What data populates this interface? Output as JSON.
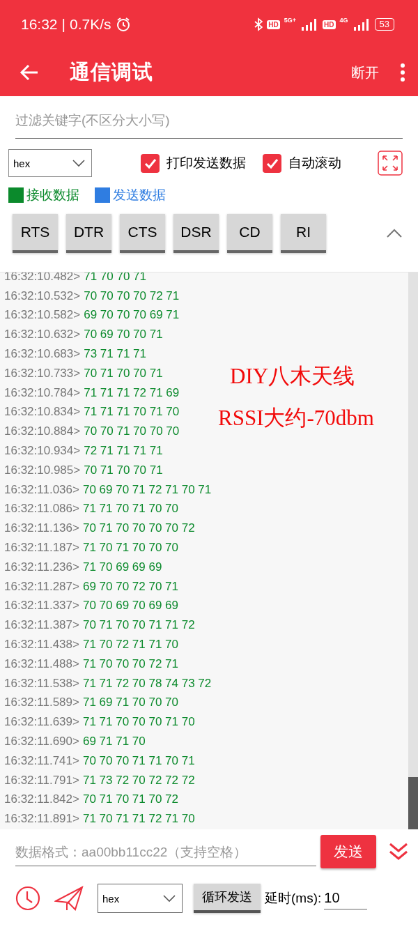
{
  "status_bar": {
    "time": "16:32",
    "separator": "|",
    "speed": "0.7K/s",
    "badges": [
      "HD",
      "5G+",
      "HD",
      "4G"
    ],
    "battery": "53"
  },
  "app_bar": {
    "title": "通信调试",
    "action": "断开"
  },
  "filter": {
    "placeholder": "过滤关键字(不区分大小写)"
  },
  "format_select": {
    "value": "hex"
  },
  "checkboxes": [
    {
      "label": "打印发送数据",
      "checked": true
    },
    {
      "label": "自动滚动",
      "checked": true
    }
  ],
  "legend": [
    {
      "label": "接收数据",
      "color": "#0b8a2c"
    },
    {
      "label": "发送数据",
      "color": "#2f7de1"
    }
  ],
  "signal_buttons": [
    "RTS",
    "DTR",
    "CTS",
    "DSR",
    "CD",
    "RI"
  ],
  "log": [
    {
      "time": "16:32:10.482>",
      "data": "71 70 70 71"
    },
    {
      "time": "16:32:10.532>",
      "data": "70 70 70 70 72 71"
    },
    {
      "time": "16:32:10.582>",
      "data": "69 70 70 70 69 71"
    },
    {
      "time": "16:32:10.632>",
      "data": "70 69 70 70 71"
    },
    {
      "time": "16:32:10.683>",
      "data": "73 71 71 71"
    },
    {
      "time": "16:32:10.733>",
      "data": "70 71 70 70 71"
    },
    {
      "time": "16:32:10.784>",
      "data": "71 71 71 72 71 69"
    },
    {
      "time": "16:32:10.834>",
      "data": "71 71 71 70 71 70"
    },
    {
      "time": "16:32:10.884>",
      "data": "70 70 71 70 70 70"
    },
    {
      "time": "16:32:10.934>",
      "data": "72 71 71 71 71"
    },
    {
      "time": "16:32:10.985>",
      "data": "70 71 70 70 71"
    },
    {
      "time": "16:32:11.036>",
      "data": "70 69 70 71 72 71 70 71"
    },
    {
      "time": "16:32:11.086>",
      "data": "71 71 70 71 70 70"
    },
    {
      "time": "16:32:11.136>",
      "data": "70 71 70 70 70 70 72"
    },
    {
      "time": "16:32:11.187>",
      "data": "71 70 71 70 70 70"
    },
    {
      "time": "16:32:11.236>",
      "data": "71 70 69 69 69"
    },
    {
      "time": "16:32:11.287>",
      "data": "69 70 70 72 70 71"
    },
    {
      "time": "16:32:11.337>",
      "data": "70 70 69 70 69 69"
    },
    {
      "time": "16:32:11.387>",
      "data": "70 71 70 70 71 71 72"
    },
    {
      "time": "16:32:11.438>",
      "data": "71 70 72 71 71 70"
    },
    {
      "time": "16:32:11.488>",
      "data": "71 70 70 70 72 71"
    },
    {
      "time": "16:32:11.538>",
      "data": "71 71 72 70 78 74 73 72"
    },
    {
      "time": "16:32:11.589>",
      "data": "71 69 71 70 70 70"
    },
    {
      "time": "16:32:11.639>",
      "data": "71 71 70 70 70 71 70"
    },
    {
      "time": "16:32:11.690>",
      "data": "69 71 71 70"
    },
    {
      "time": "16:32:11.741>",
      "data": "70 70 70 71 71 70 71"
    },
    {
      "time": "16:32:11.791>",
      "data": "71 73 72 70 72 72 72"
    },
    {
      "time": "16:32:11.842>",
      "data": "70 71 70 71 70 72"
    },
    {
      "time": "16:32:11.891>",
      "data": "71 70 71 71 72 71 70"
    }
  ],
  "annotations": [
    "DIY八木天线",
    "RSSI大约-70dbm"
  ],
  "send": {
    "placeholder": "数据格式：aa00bb11cc22（支持空格）",
    "button": "发送"
  },
  "loop": {
    "format": "hex",
    "button": "循环发送",
    "delay_label": "延时(ms):",
    "delay": "10"
  }
}
